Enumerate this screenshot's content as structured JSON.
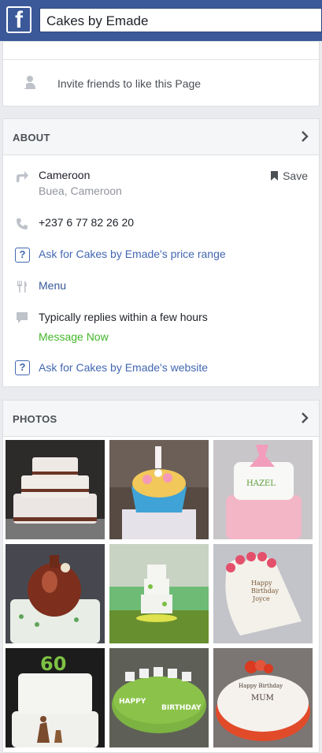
{
  "header": {
    "logo": "f",
    "search_value": "Cakes by Emade"
  },
  "invite": {
    "label": "Invite friends to like this Page"
  },
  "about": {
    "title": "ABOUT",
    "location": {
      "name": "Cameroon",
      "sub": "Buea, Cameroon",
      "save_label": "Save"
    },
    "phone": "+237 6 77 82 26 20",
    "price_range": "Ask for Cakes by Emade's price range",
    "menu": "Menu",
    "replies": "Typically replies within a few hours",
    "message_now": "Message Now",
    "website": "Ask for Cakes by Emade's website"
  },
  "photos": {
    "title": "PHOTOS",
    "items": [
      {
        "name": "cake-photo-1"
      },
      {
        "name": "cake-photo-2"
      },
      {
        "name": "cake-photo-3"
      },
      {
        "name": "cake-photo-4"
      },
      {
        "name": "cake-photo-5"
      },
      {
        "name": "cake-photo-6"
      },
      {
        "name": "cake-photo-7"
      },
      {
        "name": "cake-photo-8"
      },
      {
        "name": "cake-photo-9"
      }
    ],
    "captions": {
      "p3": "HAZEL",
      "p6_line1": "Happy",
      "p6_line2": "Birthday",
      "p6_line3": "Joyce",
      "p7": "60",
      "p8_line1": "HAPPY",
      "p8_line2": "BIRTHDAY",
      "p9_line1": "Happy Birthday",
      "p9_line2": "MUM"
    }
  },
  "colors": {
    "brand": "#3b5998",
    "link": "#4267b2",
    "green": "#42b72a"
  }
}
